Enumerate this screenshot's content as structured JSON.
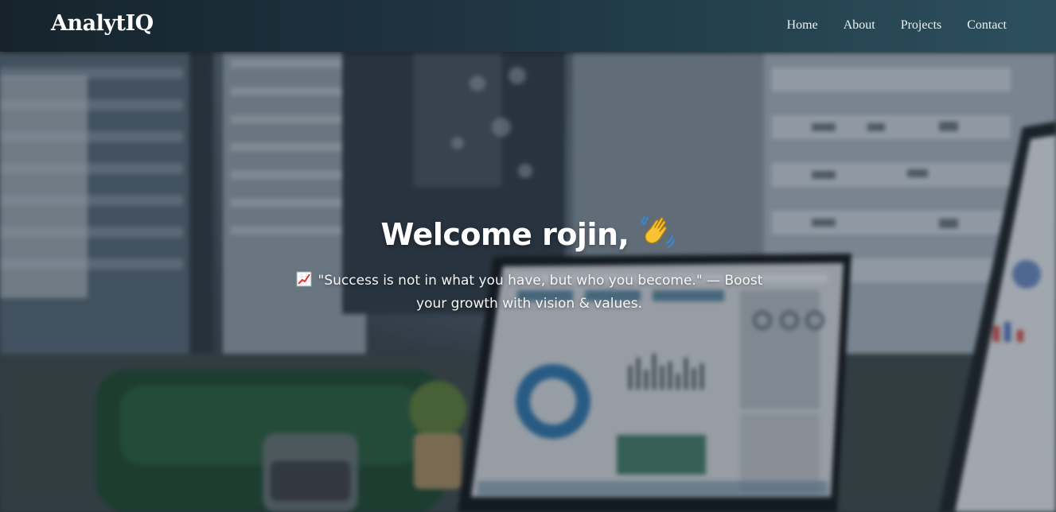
{
  "navbar": {
    "brand": "AnalytIQ",
    "links": [
      {
        "label": "Home"
      },
      {
        "label": "About"
      },
      {
        "label": "Projects"
      },
      {
        "label": "Contact"
      }
    ]
  },
  "hero": {
    "title": "Welcome rojin,",
    "title_icon": "waving-hand-icon",
    "quote_icon": "chart-increasing-icon",
    "quote": "\"Success is not in what you have, but who you become.\" — Boost your growth with vision & values."
  },
  "colors": {
    "navbar_start": "#16232c",
    "navbar_end": "#2c4f5e",
    "text": "#ffffff"
  }
}
